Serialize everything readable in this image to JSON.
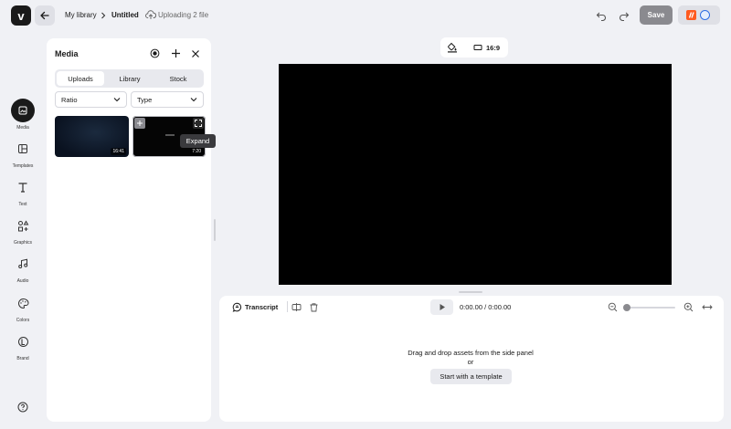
{
  "header": {
    "logo_text": "v",
    "breadcrumb": [
      "My library",
      "Untitled"
    ],
    "upload_status": "Uploading 2 file",
    "save_label": "Save"
  },
  "sidebar": {
    "items": [
      {
        "label": "Media",
        "icon": "media-icon",
        "active": true
      },
      {
        "label": "Templates",
        "icon": "templates-icon"
      },
      {
        "label": "Text",
        "icon": "text-icon"
      },
      {
        "label": "Graphics",
        "icon": "graphics-icon"
      },
      {
        "label": "Audio",
        "icon": "audio-icon"
      },
      {
        "label": "Colors",
        "icon": "colors-icon"
      },
      {
        "label": "Brand",
        "icon": "brand-icon"
      }
    ]
  },
  "media_panel": {
    "title": "Media",
    "tabs": [
      "Uploads",
      "Library",
      "Stock"
    ],
    "selected_tab": "Uploads",
    "filters": {
      "ratio": "Ratio",
      "type": "Type"
    },
    "thumbnails": [
      {
        "duration": "16:41"
      },
      {
        "duration": "7:20"
      }
    ],
    "tooltip": "Expand"
  },
  "canvas_tools": {
    "aspect_ratio": "16:9"
  },
  "timeline": {
    "transcript_label": "Transcript",
    "time": "0:00.00 / 0:00.00",
    "empty_text": "Drag and drop assets from the side panel",
    "or_text": "or",
    "template_button": "Start with a template"
  },
  "colors": {
    "accent_dark": "#1a1a1a",
    "canvas": "#000000",
    "save_disabled": "#8a8a8f",
    "app_orange": "#ff5a1f",
    "app_blue": "#2f6fe4"
  }
}
